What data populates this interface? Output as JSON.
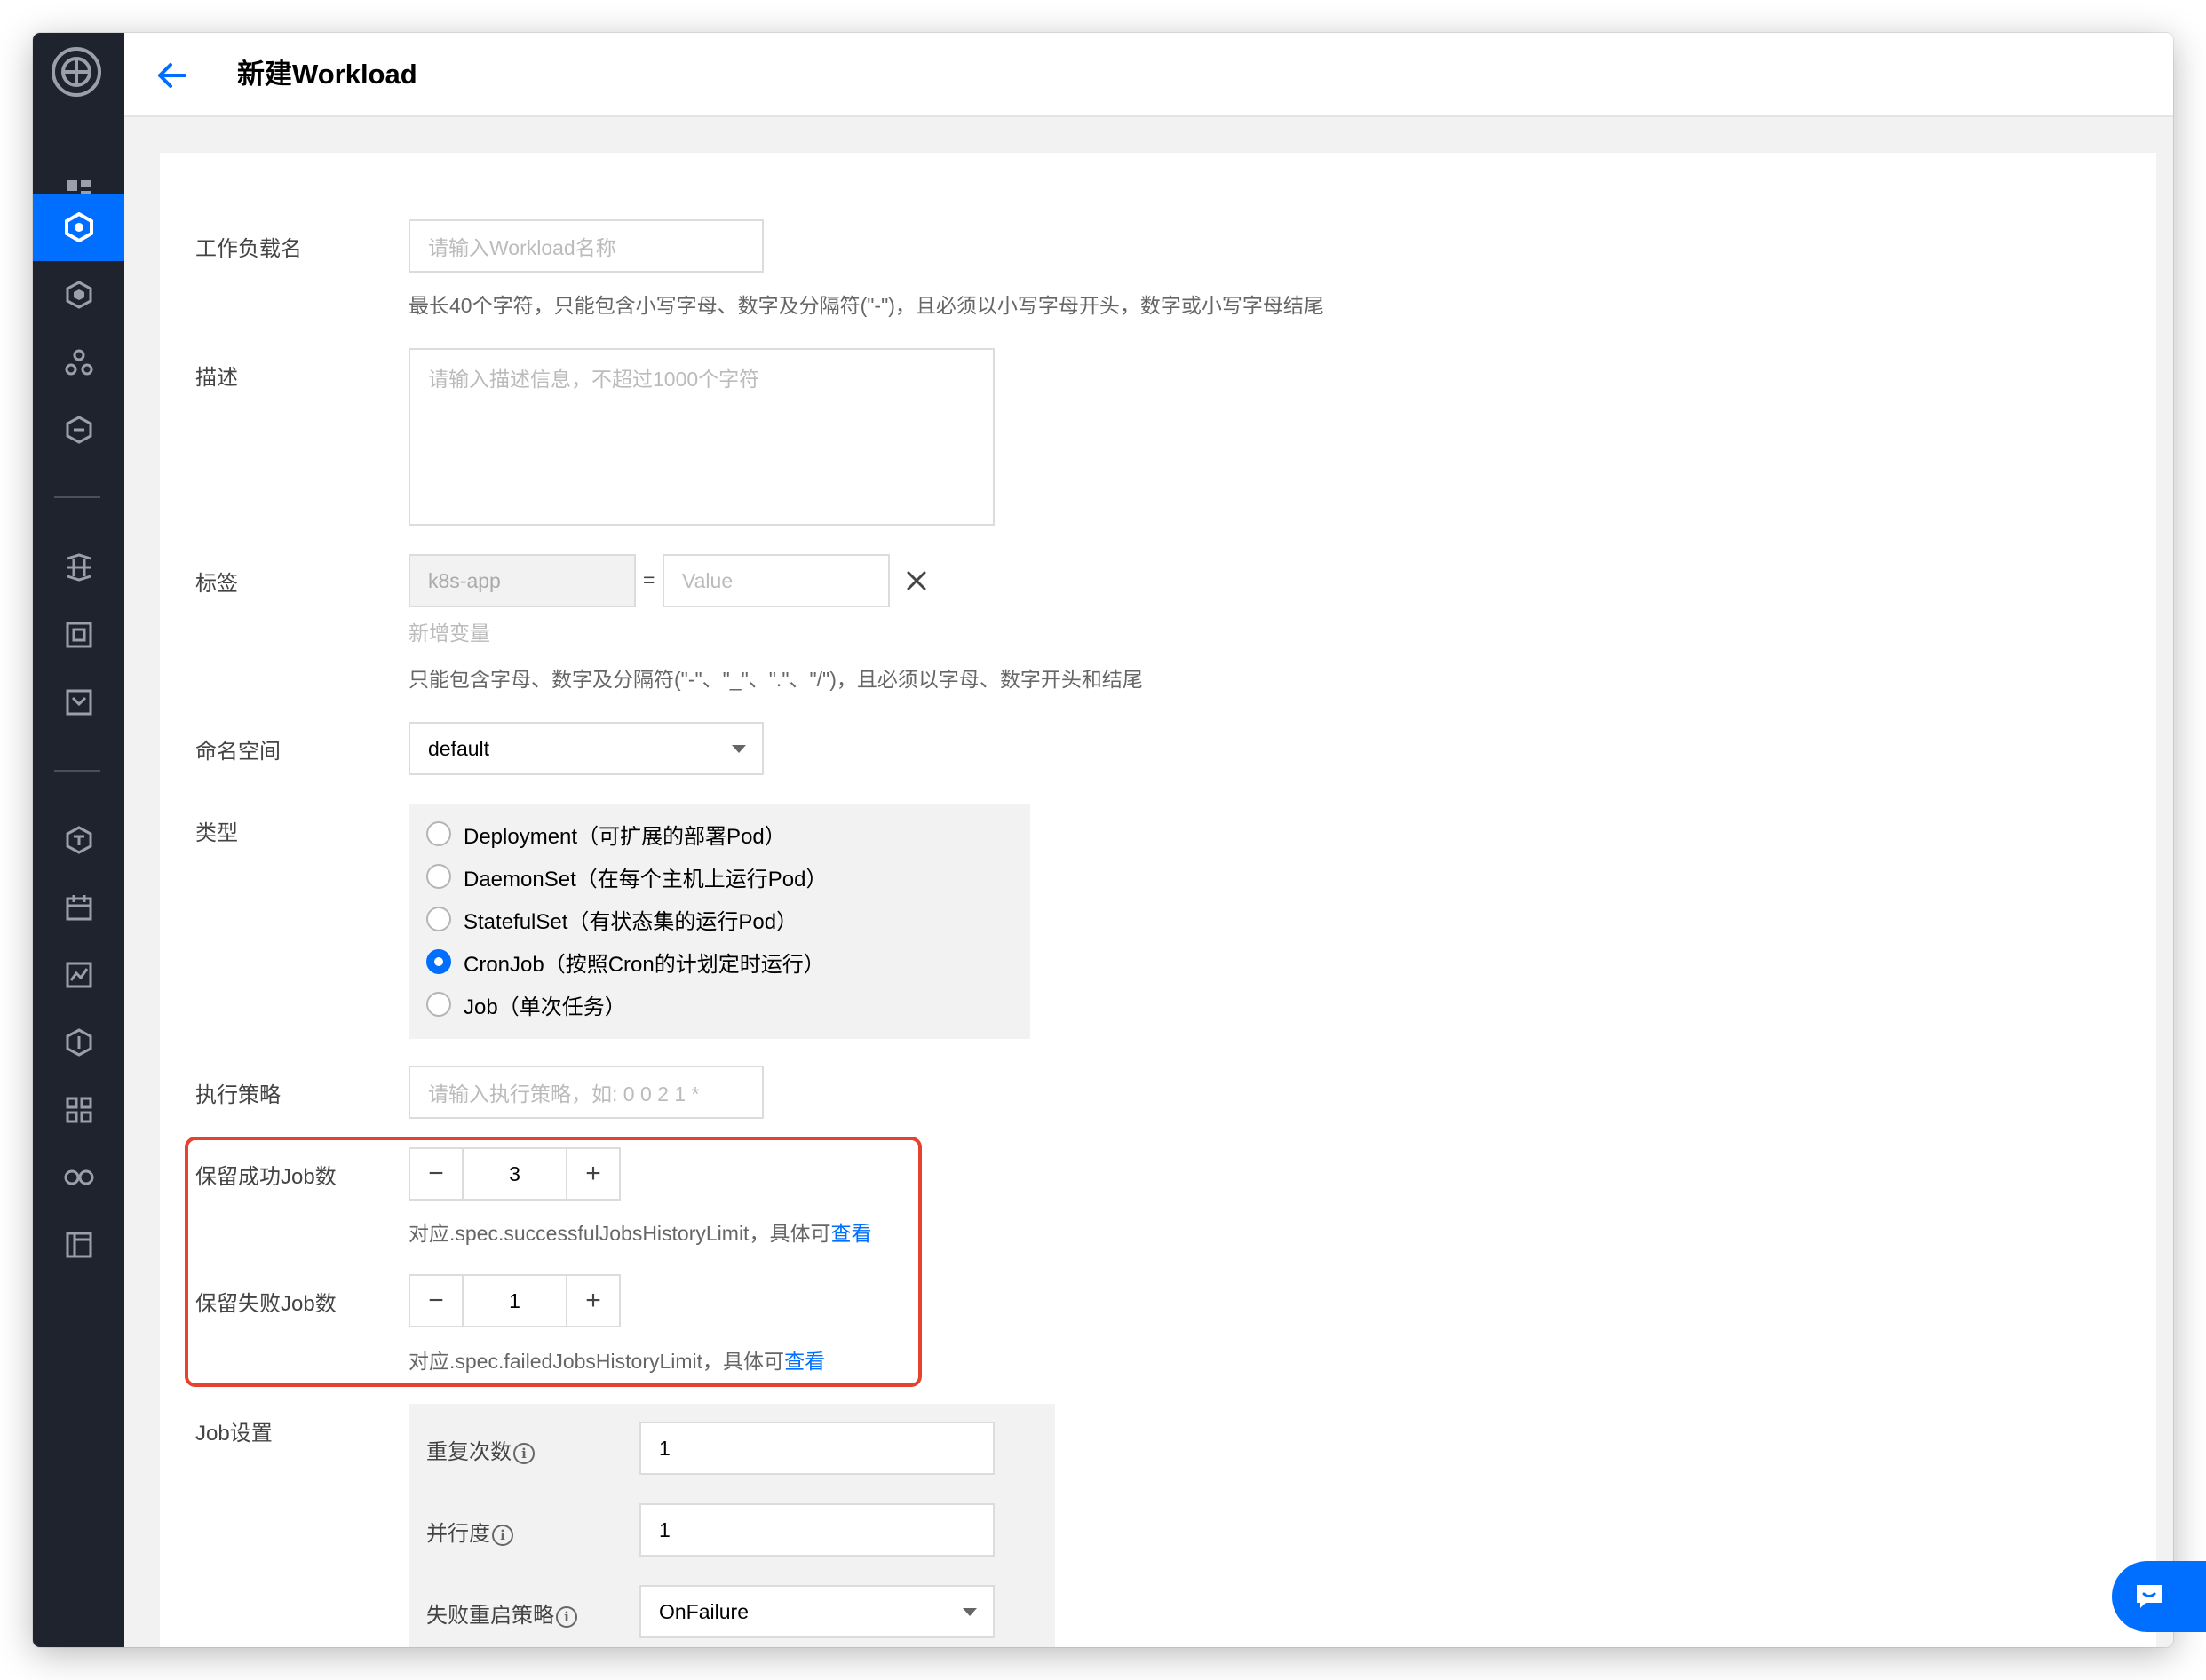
{
  "header": {
    "title": "新建Workload"
  },
  "form": {
    "name": {
      "label": "工作负载名",
      "placeholder": "请输入Workload名称",
      "help": "最长40个字符，只能包含小写字母、数字及分隔符(\"-\")，且必须以小写字母开头，数字或小写字母结尾"
    },
    "description": {
      "label": "描述",
      "placeholder": "请输入描述信息，不超过1000个字符"
    },
    "labels": {
      "label": "标签",
      "key_value": "k8s-app",
      "equals": "=",
      "value_placeholder": "Value",
      "add_link": "新增变量",
      "help": "只能包含字母、数字及分隔符(\"-\"、\"_\"、\".\"、\"/\")，且必须以字母、数字开头和结尾"
    },
    "namespace": {
      "label": "命名空间",
      "value": "default"
    },
    "type": {
      "label": "类型",
      "options": [
        {
          "label": "Deployment（可扩展的部署Pod）",
          "checked": false
        },
        {
          "label": "DaemonSet（在每个主机上运行Pod）",
          "checked": false
        },
        {
          "label": "StatefulSet（有状态集的运行Pod）",
          "checked": false
        },
        {
          "label": "CronJob（按照Cron的计划定时运行）",
          "checked": true
        },
        {
          "label": "Job（单次任务）",
          "checked": false
        }
      ]
    },
    "schedule": {
      "label": "执行策略",
      "placeholder": "请输入执行策略，如: 0 0 2 1 *"
    },
    "success_jobs": {
      "label": "保留成功Job数",
      "value": "3",
      "minus": "−",
      "plus": "+",
      "help_prefix": "对应.spec.successfulJobsHistoryLimit，具体可",
      "help_link": "查看"
    },
    "failed_jobs": {
      "label": "保留失败Job数",
      "value": "1",
      "minus": "−",
      "plus": "+",
      "help_prefix": "对应.spec.failedJobsHistoryLimit，具体可",
      "help_link": "查看"
    },
    "job_settings": {
      "label": "Job设置",
      "completions": {
        "label": "重复次数",
        "value": "1"
      },
      "parallelism": {
        "label": "并行度",
        "value": "1"
      },
      "restart_policy": {
        "label": "失败重启策略",
        "value": "OnFailure"
      },
      "info_glyph": "i"
    }
  },
  "colors": {
    "accent": "#006eff",
    "sidebar": "#1f232d",
    "highlight": "#e5432f"
  },
  "icons": {
    "sidebar": [
      "logo-icon",
      "dashboard-icon",
      "cluster-icon",
      "image-icon",
      "helm-icon",
      "service-mesh-icon",
      "middleware-icon",
      "storage-icon",
      "log-icon",
      "cube-icon",
      "calendar-icon",
      "monitor-icon",
      "security-icon",
      "apps-icon",
      "link-icon",
      "docs-icon"
    ]
  }
}
